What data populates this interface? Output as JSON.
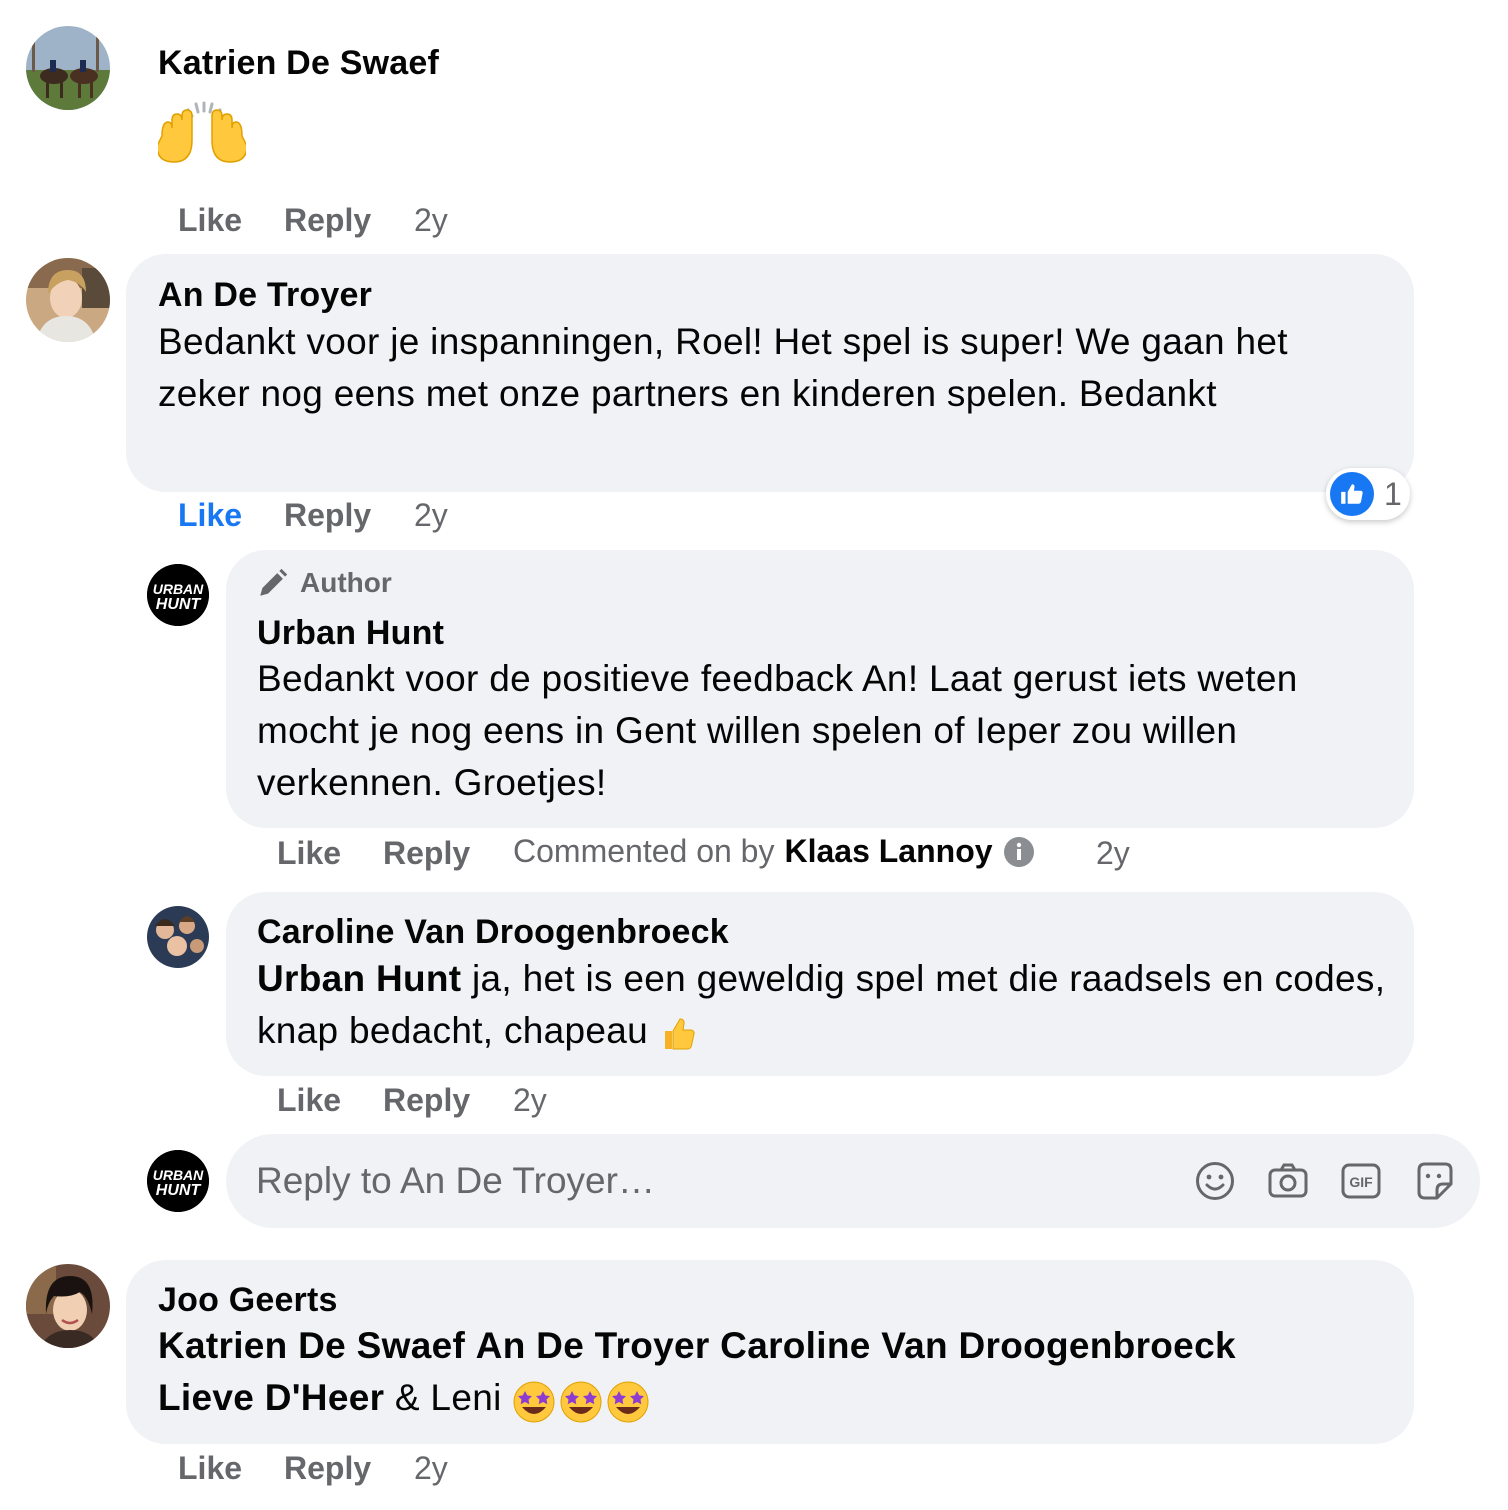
{
  "comments": [
    {
      "author": "Katrien De Swaef",
      "emoji": "raising-hands",
      "actions": {
        "like": "Like",
        "reply": "Reply",
        "time": "2y"
      }
    },
    {
      "author": "An De Troyer",
      "text": "Bedankt voor je inspanningen, Roel! Het spel is super! We gaan het zeker nog eens met onze partners en kinderen spelen. Bedankt",
      "actions": {
        "like": "Like",
        "reply": "Reply",
        "time": "2y",
        "liked": true
      },
      "reaction": {
        "icon": "thumbs-up-icon",
        "count": "1",
        "color": "#1877f2"
      },
      "replies": [
        {
          "badge": "Author",
          "author": "Urban Hunt",
          "text": "Bedankt voor de positieve feedback An! Laat gerust iets weten mocht je nog eens in Gent willen spelen of Ieper zou willen verkennen. Groetjes!",
          "actions": {
            "like": "Like",
            "reply": "Reply",
            "time": "2y"
          },
          "commented_on_by": {
            "prefix": "Commented on by",
            "name": "Klaas Lannoy"
          }
        },
        {
          "author": "Caroline Van Droogenbroeck",
          "mention": "Urban Hunt",
          "text": " ja, het is een geweldig spel met die raadsels en codes, knap bedacht, chapeau",
          "actions": {
            "like": "Like",
            "reply": "Reply",
            "time": "2y"
          }
        }
      ],
      "reply_box": {
        "avatar_text_1": "URBAN",
        "avatar_text_2": "HUNT",
        "placeholder": "Reply to An De Troyer…",
        "icons": [
          "emoji-icon",
          "camera-icon",
          "gif-icon",
          "sticker-icon"
        ],
        "gif_label": "GIF"
      }
    },
    {
      "author": "Joo Geerts",
      "mentions": [
        "Katrien De Swaef",
        "An De Troyer",
        "Caroline Van Droogenbroeck",
        "Lieve D'Heer"
      ],
      "tail": " & Leni ",
      "actions": {
        "like": "Like",
        "reply": "Reply",
        "time": "2y"
      }
    }
  ],
  "colors": {
    "bubble": "#f0f2f5",
    "secondary_text": "#65676b",
    "primary_text": "#050505",
    "like_blue": "#1877f2"
  }
}
